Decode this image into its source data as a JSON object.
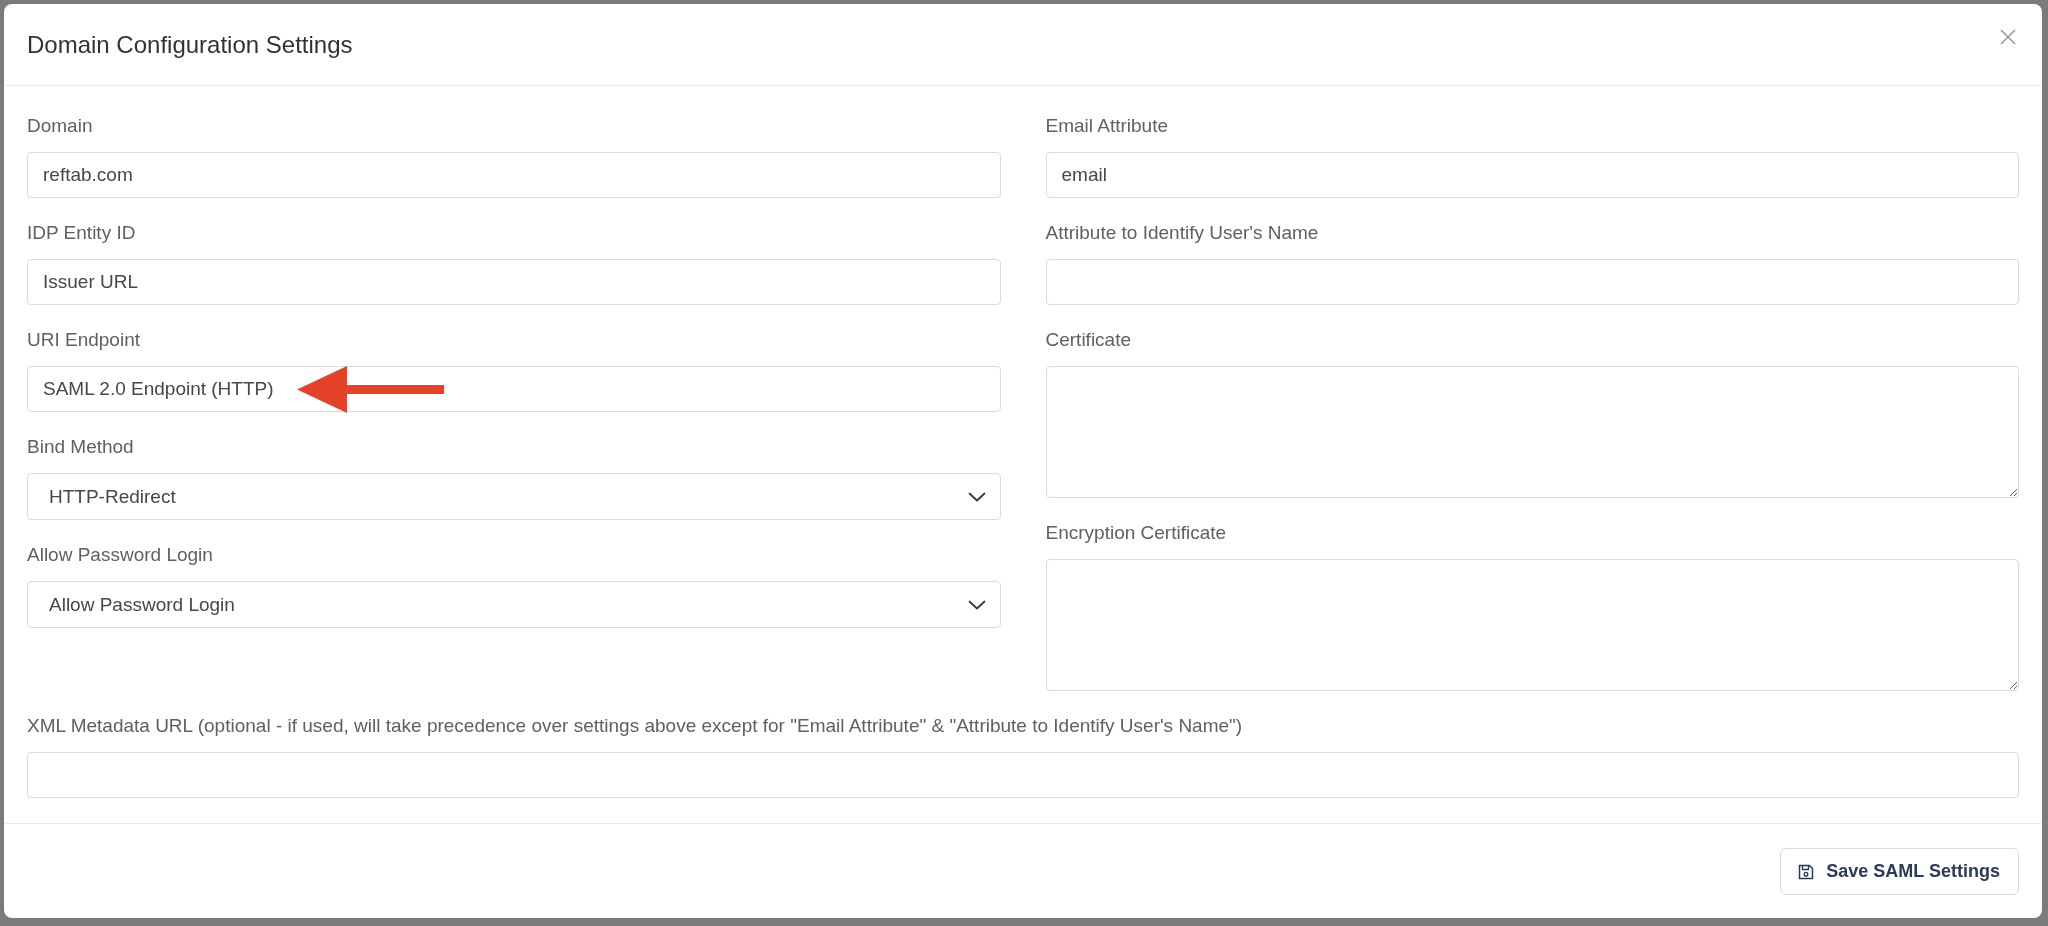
{
  "dialog": {
    "title": "Domain Configuration Settings"
  },
  "columns": [
    [
      {
        "label": "Domain",
        "kind": "text",
        "value": "reftab.com",
        "arrow": false
      },
      {
        "label": "IDP Entity ID",
        "kind": "text",
        "value": "Issuer URL",
        "arrow": false
      },
      {
        "label": "URI Endpoint",
        "kind": "text",
        "value": "SAML 2.0 Endpoint (HTTP)",
        "arrow": true
      },
      {
        "label": "Bind Method",
        "kind": "select",
        "value": "HTTP-Redirect",
        "arrow": false
      },
      {
        "label": "Allow Password Login",
        "kind": "select",
        "value": "Allow Password Login",
        "arrow": false
      }
    ],
    [
      {
        "label": "Email Attribute",
        "kind": "text",
        "value": "email",
        "arrow": false
      },
      {
        "label": "Attribute to Identify User's Name",
        "kind": "text",
        "arrow": false
      },
      {
        "label": "Certificate",
        "kind": "textarea",
        "arrow": false
      },
      {
        "label": "Encryption Certificate",
        "kind": "textarea",
        "arrow": false
      }
    ]
  ],
  "full_width_fields": [
    {
      "label": "XML Metadata URL (optional - if used, will take precedence over settings above except for \"Email Attribute\" & \"Attribute to Identify User's Name\")",
      "kind": "text",
      "arrow": false
    }
  ],
  "footer": {
    "buttons": [
      "Save SAML Settings"
    ]
  }
}
